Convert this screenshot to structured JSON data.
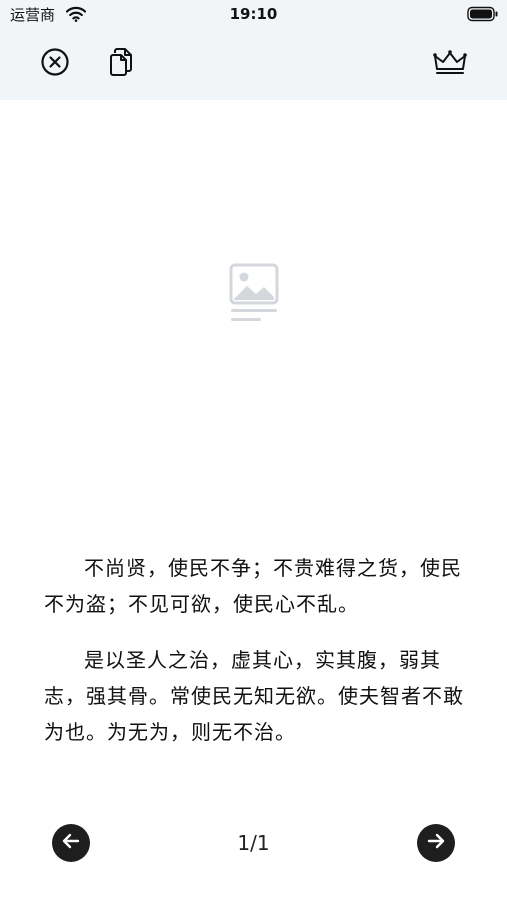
{
  "status_bar": {
    "carrier": "运营商",
    "time": "19:10"
  },
  "toolbar": {
    "close_icon": "close-circle-icon",
    "copy_icon": "copy-document-icon",
    "vip_icon": "crown-icon"
  },
  "content": {
    "image_icon": "image-placeholder-icon",
    "paragraphs": [
      "不尚贤，使民不争；不贵难得之货，使民不为盗；不见可欲，使民心不乱。",
      "是以圣人之治，虚其心，实其腹，弱其志，强其骨。常使民无知无欲。使夫智者不敢为也。为无为，则无不治。"
    ]
  },
  "pagination": {
    "page_label": "1/1",
    "prev_icon": "arrow-left-icon",
    "next_icon": "arrow-right-icon"
  }
}
